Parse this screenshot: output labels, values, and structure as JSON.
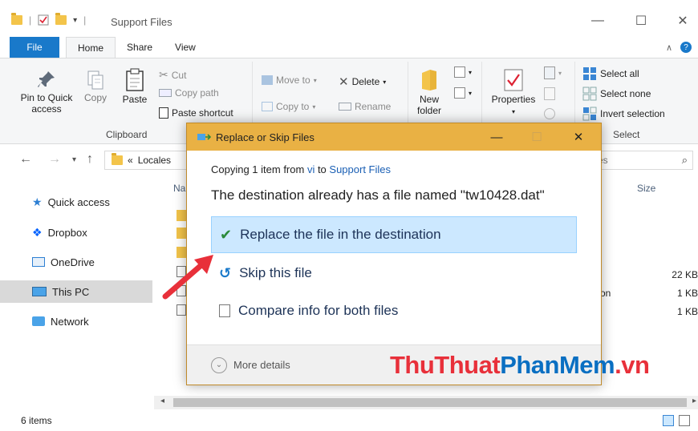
{
  "window": {
    "title": "Support Files",
    "minimize": "—",
    "maximize": "☐",
    "close": "✕"
  },
  "tabs": [
    {
      "label": "File"
    },
    {
      "label": "Home"
    },
    {
      "label": "Share"
    },
    {
      "label": "View"
    }
  ],
  "ribbon": {
    "clipboard": {
      "pin": "Pin to Quick access",
      "copy": "Copy",
      "paste": "Paste",
      "cut": "Cut",
      "copy_path": "Copy path",
      "paste_shortcut": "Paste shortcut",
      "label": "Clipboard"
    },
    "organize": {
      "move_to": "Move to",
      "copy_to": "Copy to",
      "delete": "Delete",
      "rename": "Rename"
    },
    "new": {
      "new_folder": "New folder"
    },
    "open": {
      "properties": "Properties"
    },
    "select": {
      "select_all": "Select all",
      "select_none": "Select none",
      "invert": "Invert selection",
      "label": "Select"
    }
  },
  "address": {
    "prefix": "«",
    "crumb": "Locales",
    "search_partial": "es"
  },
  "navpane": {
    "items": [
      {
        "label": "Quick access"
      },
      {
        "label": "Dropbox"
      },
      {
        "label": "OneDrive"
      },
      {
        "label": "This PC"
      },
      {
        "label": "Network"
      }
    ]
  },
  "filelist": {
    "name_header_partial": "Na",
    "size_header": "Size",
    "type_partial": "on",
    "sizes": [
      "22 KB",
      "1 KB",
      "1 KB"
    ]
  },
  "status": {
    "items": "6 items"
  },
  "dialog": {
    "title": "Replace or Skip Files",
    "copying_prefix": "Copying 1 item from ",
    "from": "vi",
    "to_word": " to ",
    "to": "Support Files",
    "message": "The destination already has a file named \"tw10428.dat\"",
    "options": [
      {
        "label": "Replace the file in the destination"
      },
      {
        "label": "Skip this file"
      },
      {
        "label": "Compare info for both files"
      }
    ],
    "more_details": "More details"
  },
  "watermark": {
    "part1": "ThuThuat",
    "part2": "PhanMem",
    "part3": ".vn"
  },
  "colors": {
    "file_tab": "#1979ca",
    "dialog_title": "#e9b144",
    "highlight": "#cce8ff",
    "arrow": "#e8303a"
  }
}
